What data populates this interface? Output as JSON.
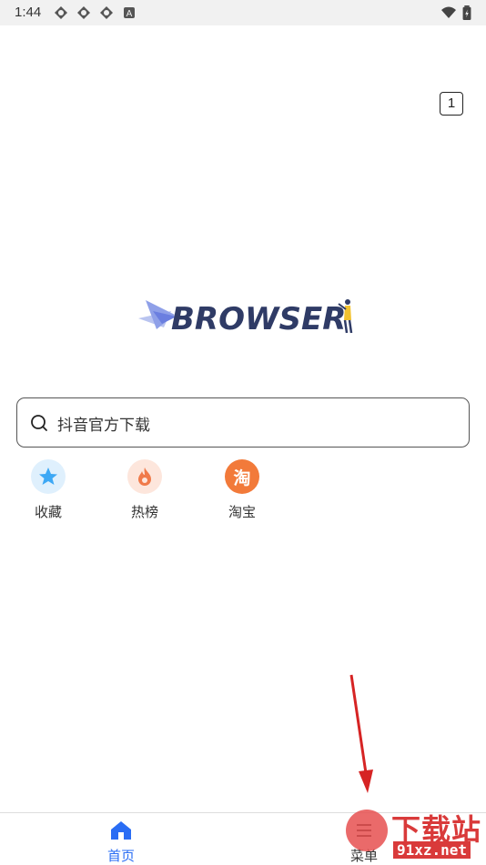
{
  "status_bar": {
    "time": "1:44",
    "notification_icons": [
      "app-icon",
      "app-icon",
      "app-icon",
      "a-icon"
    ],
    "right_icons": [
      "wifi-icon",
      "battery-icon"
    ]
  },
  "header": {
    "tab_count": "1"
  },
  "logo": {
    "text": "BROWSER"
  },
  "search": {
    "text": "抖音官方下载"
  },
  "quick_links": [
    {
      "label": "收藏",
      "icon": "star-icon",
      "color": "#3da8f5"
    },
    {
      "label": "热榜",
      "icon": "flame-icon",
      "color": "#f07a4a"
    },
    {
      "label": "淘宝",
      "icon": "taobao-icon",
      "icon_text": "淘",
      "color": "#f27a3a"
    }
  ],
  "bottom_nav": {
    "home_label": "首页",
    "menu_label": "菜单"
  },
  "watermark": {
    "big": "下载站",
    "small": "91xz.net"
  },
  "colors": {
    "accent": "#2a6df4",
    "arrow": "#d62424"
  }
}
